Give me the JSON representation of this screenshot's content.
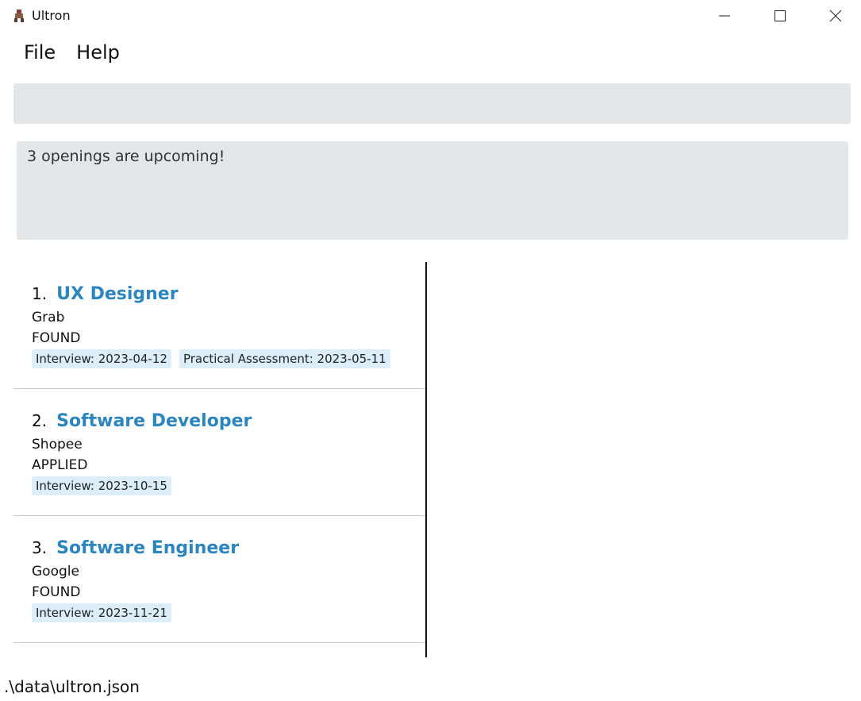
{
  "window": {
    "title": "Ultron",
    "icon": "ultron-app-icon"
  },
  "menu": {
    "items": [
      {
        "label": "File"
      },
      {
        "label": "Help"
      }
    ]
  },
  "command": {
    "value": "",
    "placeholder": ""
  },
  "result": {
    "message": "3 openings are upcoming!"
  },
  "openings": [
    {
      "index": "1.",
      "role": "UX Designer",
      "company": "Grab",
      "status": "FOUND",
      "keydates": [
        "Interview: 2023-04-12",
        "Practical Assessment: 2023-05-11"
      ]
    },
    {
      "index": "2.",
      "role": "Software Developer",
      "company": "Shopee",
      "status": "APPLIED",
      "keydates": [
        "Interview: 2023-10-15"
      ]
    },
    {
      "index": "3.",
      "role": "Software Engineer",
      "company": "Google",
      "status": "FOUND",
      "keydates": [
        "Interview: 2023-11-21"
      ]
    }
  ],
  "statusbar": {
    "path": ".\\data\\ultron.json"
  },
  "colors": {
    "role_title": "#2b86c0",
    "tag_background": "#dbeef9",
    "box_background": "#e4e7ea"
  }
}
